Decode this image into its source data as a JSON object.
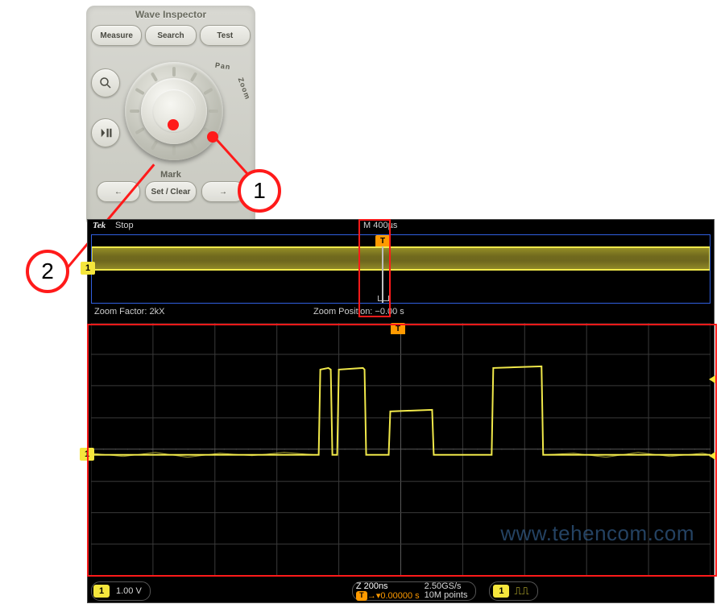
{
  "panel": {
    "title": "Wave Inspector",
    "buttons": {
      "measure": "Measure",
      "search": "Search",
      "test": "Test"
    },
    "arc": {
      "pan": "Pan",
      "zoom": "Zoom"
    },
    "mark": {
      "label": "Mark",
      "left": "←",
      "setclear": "Set / Clear",
      "right": "→"
    },
    "side": {
      "mag": "magnifier-icon",
      "play": "play-pause-icon"
    }
  },
  "callouts": {
    "one": "1",
    "two": "2"
  },
  "scope": {
    "tek": "Tek",
    "state": "Stop",
    "timebase_main": "M 400µs",
    "overview": {
      "channel": "1",
      "trigger_glyph": "T"
    },
    "zoom": {
      "factor_label": "Zoom Factor: 2kX",
      "position_label": "Zoom Position: −0.00 s",
      "channel": "1",
      "trigger_glyph": "T"
    },
    "watermark": "www.tehencom.com",
    "status": {
      "ch": "1",
      "vdiv": "1.00 V",
      "z_tdiv": "Z 200ns",
      "trig_time": "0.00000 s",
      "srate": "2.50GS/s",
      "record": "10M points",
      "trig_ch": "1",
      "trig_glyph": "T"
    }
  }
}
